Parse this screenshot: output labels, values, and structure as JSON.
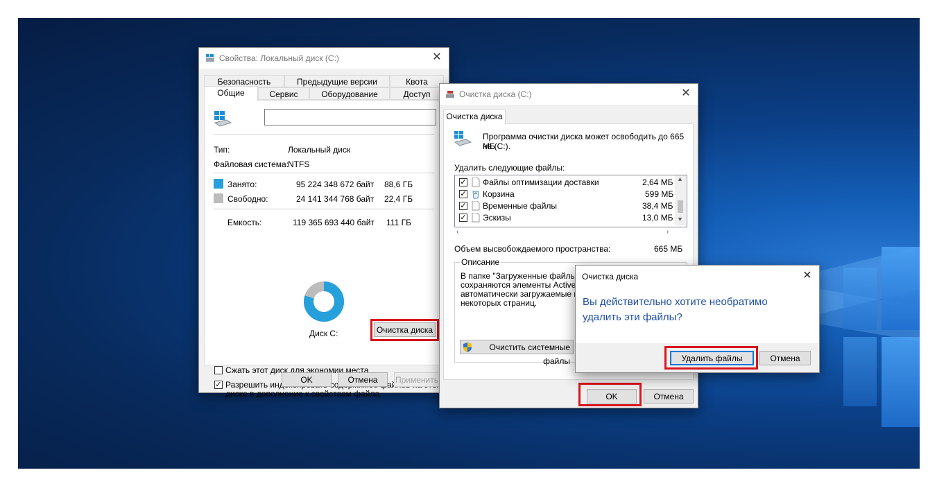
{
  "props": {
    "title": "Свойства: Локальный диск (C:)",
    "tabs_row1": [
      "Безопасность",
      "Предыдущие версии",
      "Квота"
    ],
    "tabs_row2": [
      "Общие",
      "Сервис",
      "Оборудование",
      "Доступ"
    ],
    "name_value": "",
    "type_label": "Тип:",
    "type_value": "Локальный диск",
    "fs_label": "Файловая система:",
    "fs_value": "NTFS",
    "used_label": "Занято:",
    "used_bytes": "95 224 348 672 байт",
    "used_gb": "88,6 ГБ",
    "free_label": "Свободно:",
    "free_bytes": "24 141 344 768 байт",
    "free_gb": "22,4 ГБ",
    "cap_label": "Емкость:",
    "cap_bytes": "119 365 693 440 байт",
    "cap_gb": "111 ГБ",
    "used_color": "#26a0da",
    "free_color": "#bcbcbc",
    "disk_label": "Диск C:",
    "cleanup_button": "Очистка диска",
    "compress_label": "Сжать этот диск для экономии места",
    "compress_checked": false,
    "index_label_1": "Разрешить индексировать содержимое файлов на этом",
    "index_label_2": "диске в дополнение к свойствам файла",
    "index_checked": true,
    "ok": "OK",
    "cancel": "Отмена",
    "apply": "Применить"
  },
  "cleanup": {
    "title": "Очистка диска  (C:)",
    "tab": "Очистка диска",
    "intro_1": "Программа очистки диска может освободить до 665 МБ",
    "intro_2": "на  (C:).",
    "delete_label": "Удалить следующие файлы:",
    "files": [
      {
        "name": "Файлы оптимизации доставки",
        "size": "2,64 МБ",
        "checked": true,
        "icon": "file-icon"
      },
      {
        "name": "Корзина",
        "size": "599 МБ",
        "checked": true,
        "icon": "recycle-bin-icon"
      },
      {
        "name": "Временные файлы",
        "size": "38,4 МБ",
        "checked": true,
        "icon": "file-icon"
      },
      {
        "name": "Эскизы",
        "size": "13,0 МБ",
        "checked": true,
        "icon": "file-icon"
      }
    ],
    "space_label": "Объем высвобождаемого пространства:",
    "space_value": "665 МБ",
    "desc_legend": "Описание",
    "desc_lines": [
      "В папке \"Загруженные файлы пр",
      "сохраняются элементы ActiveX и",
      "автоматически загружаемые из",
      "некоторых страниц."
    ],
    "system_button": "Очистить системные файлы",
    "ok": "OK",
    "cancel": "Отмена"
  },
  "confirm": {
    "title": "Очистка диска",
    "message_1": "Вы действительно хотите необратимо",
    "message_2": "удалить эти файлы?",
    "delete_button": "Удалить файлы",
    "cancel_button": "Отмена"
  }
}
